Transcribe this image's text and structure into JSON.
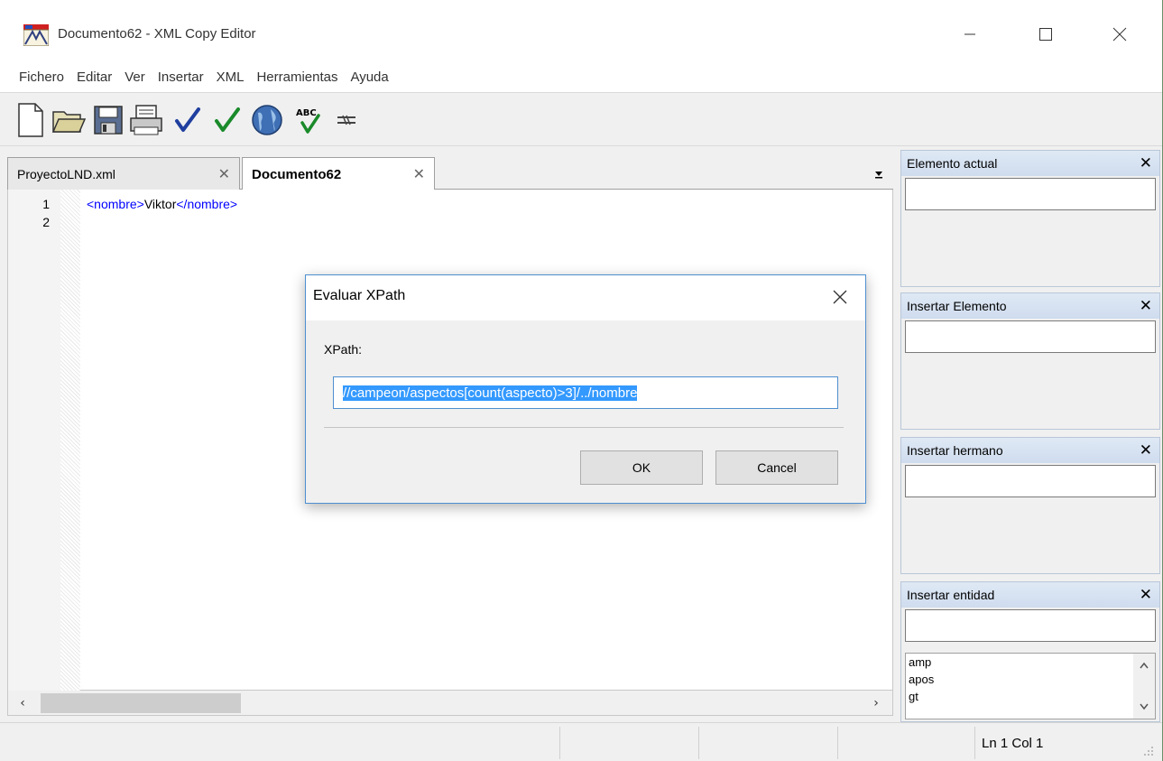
{
  "window": {
    "title": "Documento62 - XML Copy Editor"
  },
  "menu": [
    "Fichero",
    "Editar",
    "Ver",
    "Insertar",
    "XML",
    "Herramientas",
    "Ayuda"
  ],
  "toolbar": {
    "icons": [
      "new-document-icon",
      "open-folder-icon",
      "save-icon",
      "print-icon",
      "check-wellformed-icon",
      "validate-icon",
      "browser-globe-icon",
      "spellcheck-icon",
      "pretty-print-icon"
    ],
    "spellcheck_text": "ABC"
  },
  "tabs": [
    {
      "label": "ProyectoLND.xml",
      "active": false
    },
    {
      "label": "Documento62",
      "active": true
    }
  ],
  "editor": {
    "line_numbers": [
      "1",
      "2"
    ],
    "lines": [
      {
        "open_tag": "<nombre>",
        "text": "Viktor",
        "close_tag": "</nombre>"
      }
    ]
  },
  "panels": [
    {
      "title": "Elemento actual"
    },
    {
      "title": "Insertar Elemento"
    },
    {
      "title": "Insertar hermano"
    },
    {
      "title": "Insertar entidad",
      "items": [
        "amp",
        "apos",
        "gt"
      ]
    }
  ],
  "status": {
    "position": "Ln 1 Col 1"
  },
  "dialog": {
    "title": "Evaluar XPath",
    "label": "XPath:",
    "value": "//campeon/aspectos[count(aspecto)>3]/../nombre",
    "ok_label": "OK",
    "cancel_label": "Cancel"
  },
  "colors": {
    "tag": "#0000ff",
    "selection": "#3399ff",
    "dialog_border": "#4e8fd0"
  }
}
